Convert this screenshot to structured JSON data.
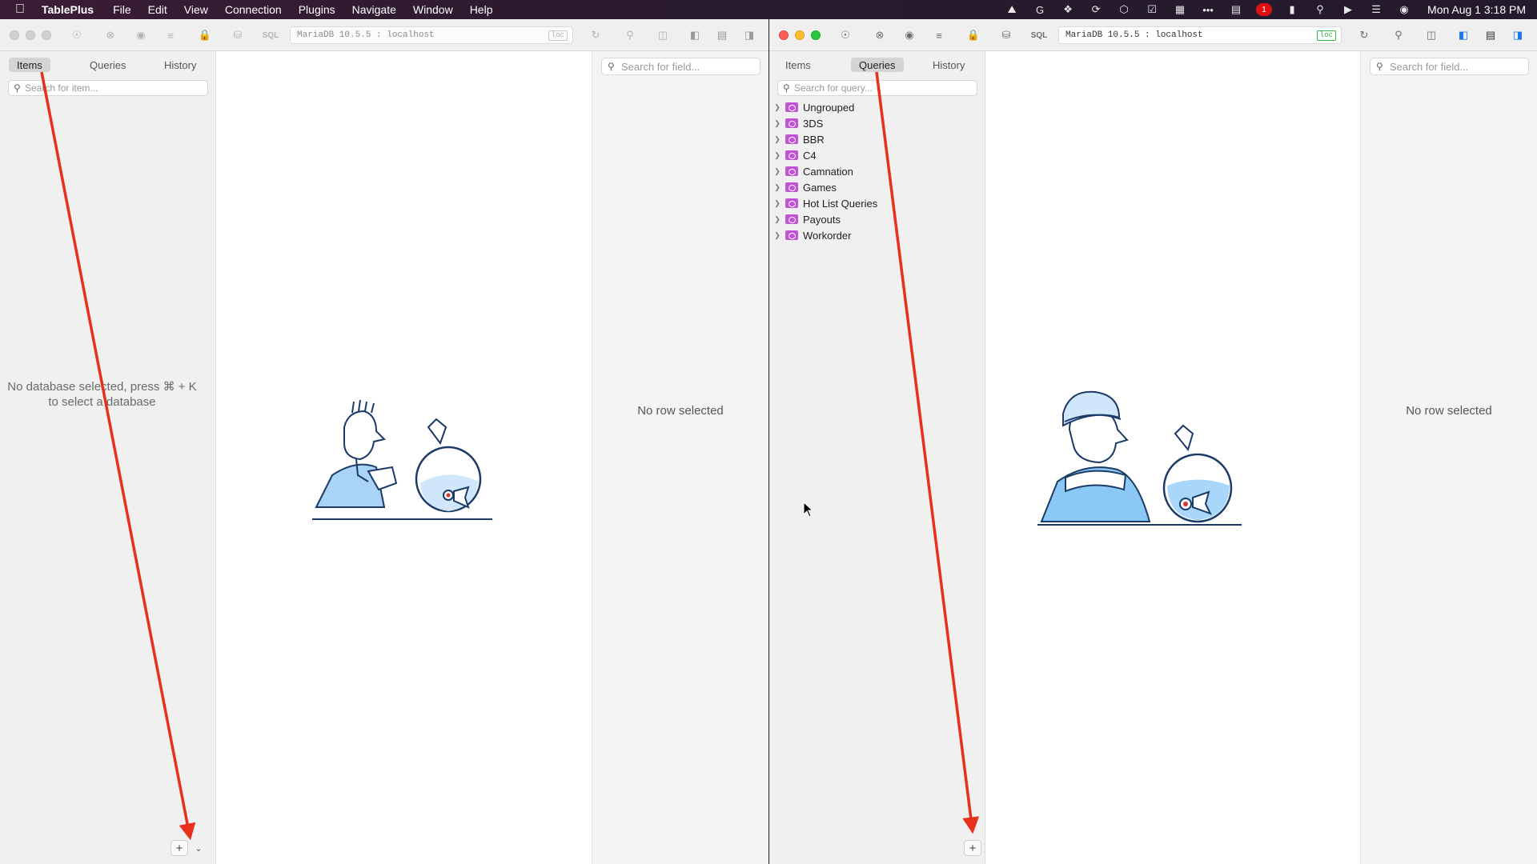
{
  "menubar": {
    "app_name": "TablePlus",
    "items": [
      "File",
      "Edit",
      "View",
      "Connection",
      "Plugins",
      "Navigate",
      "Window",
      "Help"
    ],
    "badge_count": "1",
    "datetime": "Mon Aug 1  3:18 PM"
  },
  "left_window": {
    "connection": "MariaDB 10.5.5 : localhost",
    "loc_badge": "loc",
    "sql_label": "SQL",
    "tabs": [
      "Items",
      "Queries",
      "History"
    ],
    "selected_tab": "Items",
    "search_placeholder": "Search for item...",
    "empty_line1": "No database selected, press ⌘ + K",
    "empty_line2": "to select a database",
    "field_search_placeholder": "Search for field...",
    "no_row": "No row selected"
  },
  "right_window": {
    "connection": "MariaDB 10.5.5 : localhost",
    "loc_badge": "loc",
    "sql_label": "SQL",
    "tabs": [
      "Items",
      "Queries",
      "History"
    ],
    "selected_tab": "Queries",
    "search_placeholder": "Search for query...",
    "folders": [
      "Ungrouped",
      "3DS",
      "BBR",
      "C4",
      "Camnation",
      "Games",
      "Hot List Queries",
      "Payouts",
      "Workorder"
    ],
    "field_search_placeholder": "Search for field...",
    "no_row": "No row selected"
  },
  "annotation": {
    "arrow_color": "#e8301c"
  }
}
